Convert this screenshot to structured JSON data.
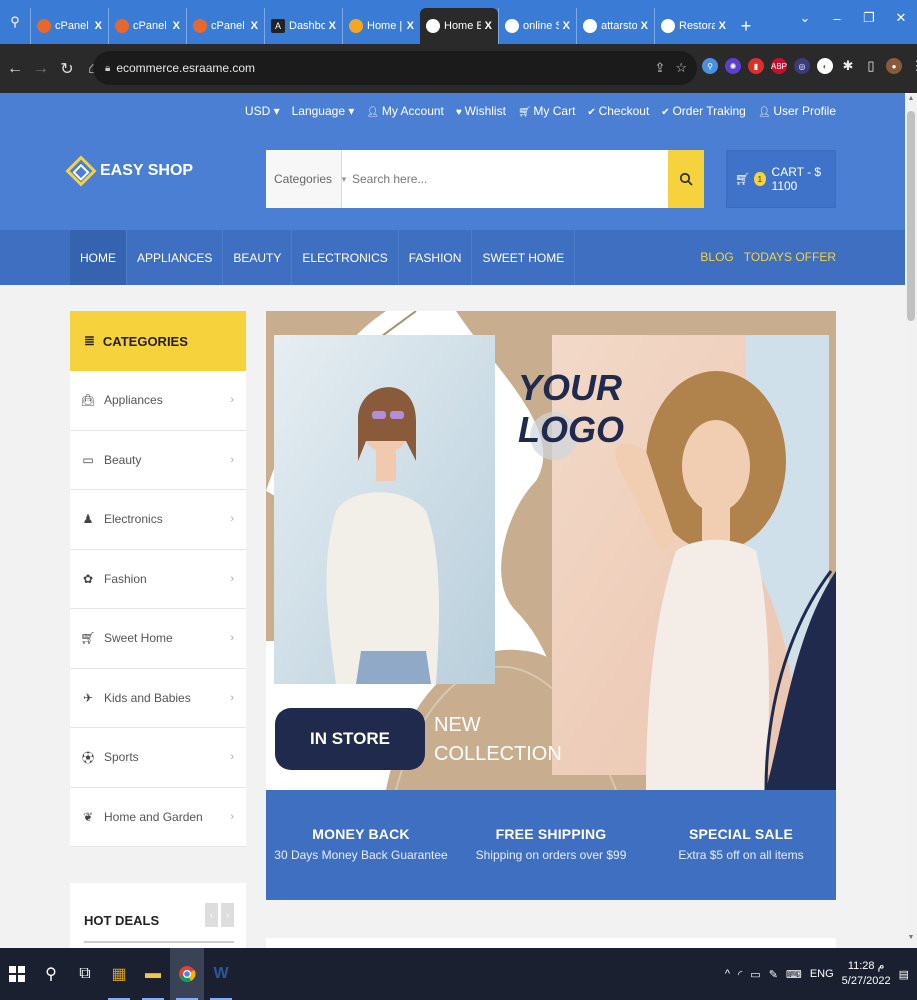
{
  "browser": {
    "tabs": [
      {
        "title": "cPanel - S",
        "fav_color": "#e8672c"
      },
      {
        "title": "cPanel File",
        "fav_color": "#e8672c"
      },
      {
        "title": "cPanel File",
        "fav_color": "#e8672c"
      },
      {
        "title": "Dashboard",
        "fav_color": "#222222"
      },
      {
        "title": "Home | Ea",
        "fav_color": "#f6a623"
      },
      {
        "title": "Home Eas",
        "fav_color": "#ffffff",
        "active": true
      },
      {
        "title": "online Sh",
        "fav_color": "#ffffff"
      },
      {
        "title": "attarstore",
        "fav_color": "#ffffff"
      },
      {
        "title": "Restoran",
        "fav_color": "#ffffff"
      }
    ],
    "fav_letter_dashboard": "A",
    "tab_close": "X",
    "new_tab": "+",
    "url": "ecommerce.esraame.com"
  },
  "site": {
    "toplinks": [
      "USD ▾",
      "Language ▾",
      "My Account",
      "Wishlist",
      "My Cart",
      "Checkout",
      "Order Traking",
      "User Profile"
    ],
    "logo": "EASY SHOP",
    "search": {
      "category": "Categories",
      "placeholder": "Search here..."
    },
    "cart": {
      "count": "1",
      "label": "CART - $ 1100"
    },
    "nav": [
      "HOME",
      "APPLIANCES",
      "BEAUTY",
      "ELECTRONICS",
      "FASHION",
      "SWEET HOME"
    ],
    "nav_right": [
      "BLOG",
      "TODAYS OFFER"
    ],
    "categories_title": "CATEGORIES",
    "categories": [
      {
        "label": "Appliances",
        "icon": "shopping-bag-icon"
      },
      {
        "label": "Beauty",
        "icon": "laptop-icon"
      },
      {
        "label": "Electronics",
        "icon": "user-icon"
      },
      {
        "label": "Fashion",
        "icon": "paw-icon"
      },
      {
        "label": "Sweet Home",
        "icon": "cart-icon"
      },
      {
        "label": "Kids and Babies",
        "icon": "plane-icon"
      },
      {
        "label": "Sports",
        "icon": "ball-icon"
      },
      {
        "label": "Home and Garden",
        "icon": "leaf-icon"
      }
    ],
    "hot_deals": "HOT DEALS",
    "banner": {
      "logo_line1": "YOUR",
      "logo_line2": "LOGO",
      "in_store": "IN STORE",
      "new_line1": "NEW",
      "new_line2": "COLLECTION"
    },
    "features": [
      {
        "title": "MONEY BACK",
        "sub": "30 Days Money Back Guarantee"
      },
      {
        "title": "FREE SHIPPING",
        "sub": "Shipping on orders over $99"
      },
      {
        "title": "SPECIAL SALE",
        "sub": "Extra $5 off on all items"
      }
    ]
  },
  "taskbar": {
    "lang": "ENG",
    "time": "11:28 م",
    "date": "5/27/2022"
  },
  "colors": {
    "brand_blue": "#4a7fd4",
    "accent_yellow": "#f6d33c",
    "navy": "#1f2a4d",
    "tan": "#c8ad8e"
  }
}
